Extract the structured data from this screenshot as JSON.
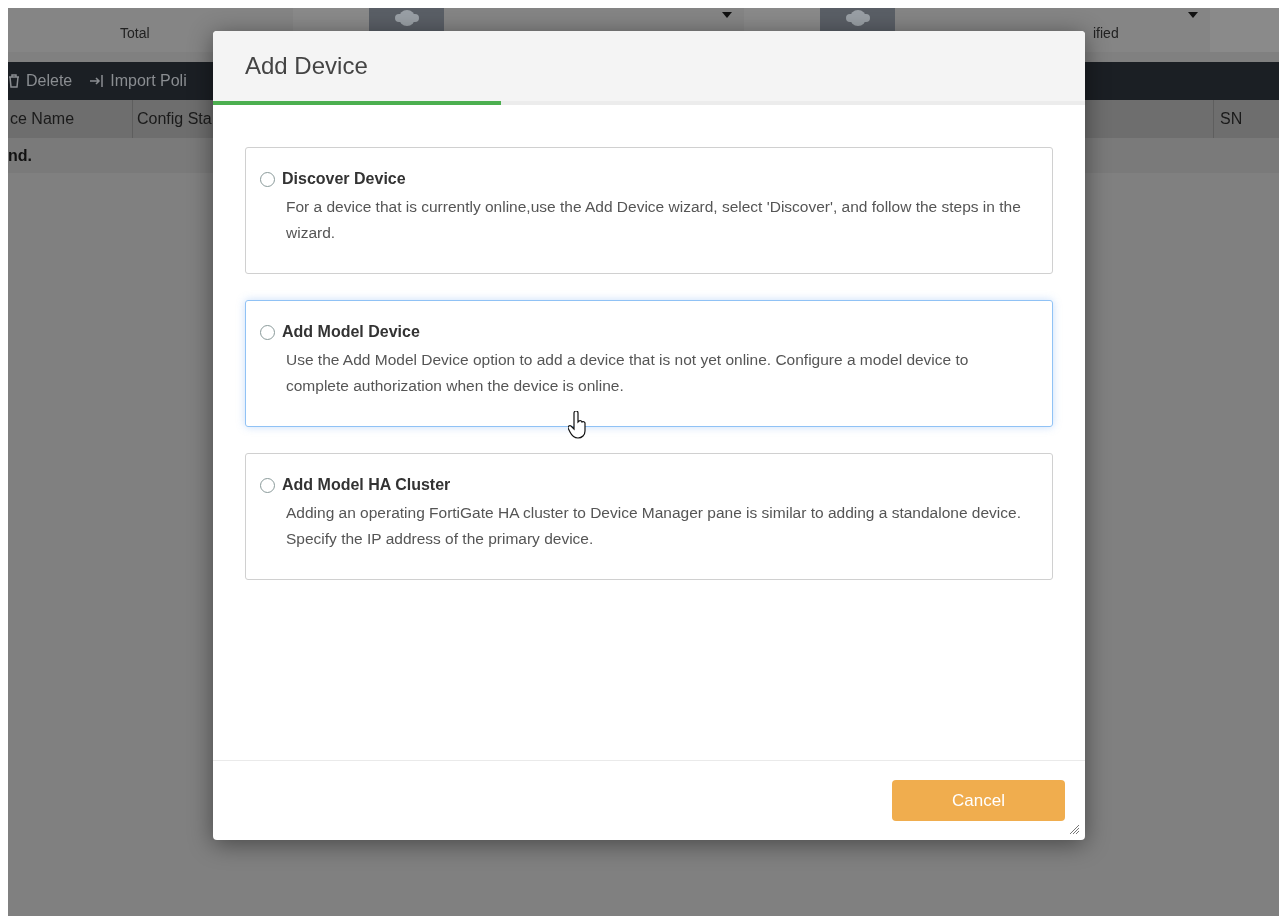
{
  "background": {
    "summary_cards": [
      {
        "label": "Total",
        "dropdown": false
      },
      {
        "dropdown": true
      },
      {
        "label": "ified",
        "dropdown": true
      }
    ],
    "toolbar": [
      {
        "label": "Delete",
        "kind": "delete"
      },
      {
        "label": "Import Poli",
        "kind": "import"
      }
    ],
    "columns": [
      "ce Name",
      "Config Sta",
      "SN"
    ],
    "rows": [
      "nd."
    ]
  },
  "dialog": {
    "title": "Add Device",
    "progress": {
      "level": 0.33
    },
    "options": [
      {
        "title": "Discover Device",
        "description": "For a device that is currently online,use the Add Device wizard, select 'Discover', and follow the steps in the wizard.",
        "selected": false,
        "hovered": false
      },
      {
        "title": "Add Model Device",
        "description": "Use the Add Model Device option to add a device that is not yet online. Configure a model device to complete authorization when the device is online.",
        "selected": false,
        "hovered": true
      },
      {
        "title": "Add Model HA Cluster",
        "description": "Adding an operating FortiGate HA cluster to Device Manager pane is similar to adding a standalone device. Specify the IP address of the primary device.",
        "selected": false,
        "hovered": false
      }
    ],
    "buttons": [
      {
        "label": "Cancel"
      }
    ]
  }
}
